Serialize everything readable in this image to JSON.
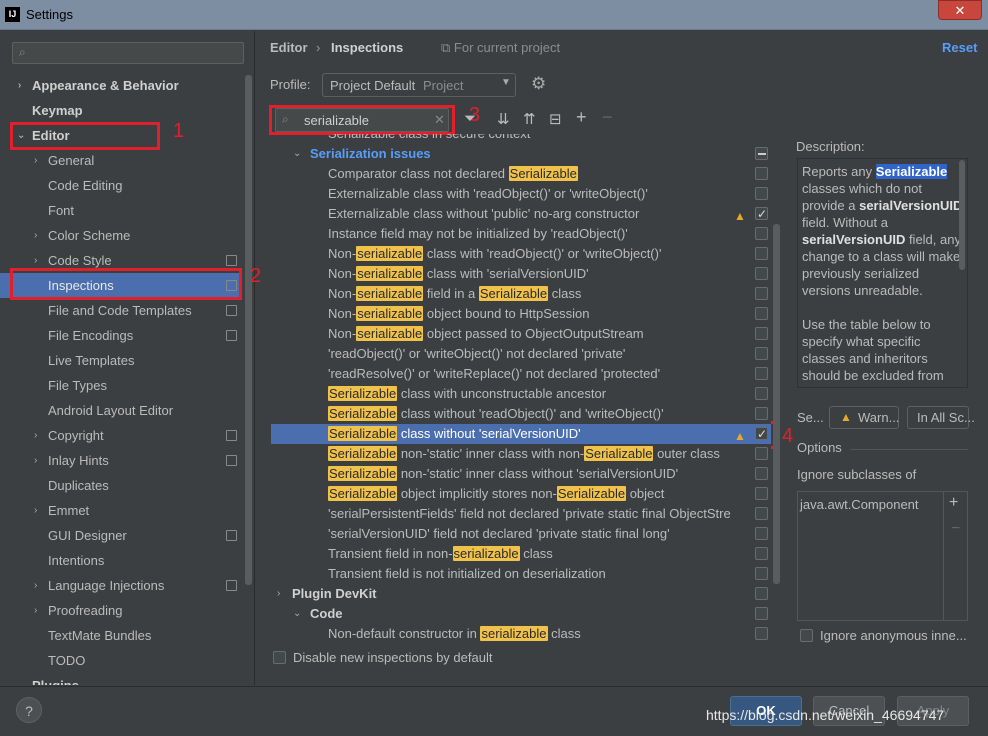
{
  "window": {
    "title": "Settings",
    "app_icon_text": "IJ",
    "close": "✕"
  },
  "left": {
    "search_placeholder": "",
    "items": [
      {
        "label": "Appearance & Behavior",
        "arrow": "›",
        "bold": true
      },
      {
        "label": "Keymap",
        "bold": true
      },
      {
        "label": "Editor",
        "arrow": "⌄",
        "bold": true
      },
      {
        "label": "General",
        "arrow": "›"
      },
      {
        "label": "Code Editing"
      },
      {
        "label": "Font"
      },
      {
        "label": "Color Scheme",
        "arrow": "›"
      },
      {
        "label": "Code Style",
        "arrow": "›"
      },
      {
        "label": "Inspections"
      },
      {
        "label": "File and Code Templates"
      },
      {
        "label": "File Encodings"
      },
      {
        "label": "Live Templates"
      },
      {
        "label": "File Types"
      },
      {
        "label": "Android Layout Editor"
      },
      {
        "label": "Copyright",
        "arrow": "›"
      },
      {
        "label": "Inlay Hints",
        "arrow": "›"
      },
      {
        "label": "Duplicates"
      },
      {
        "label": "Emmet",
        "arrow": "›"
      },
      {
        "label": "GUI Designer"
      },
      {
        "label": "Intentions"
      },
      {
        "label": "Language Injections",
        "arrow": "›"
      },
      {
        "label": "Proofreading",
        "arrow": "›"
      },
      {
        "label": "TextMate Bundles"
      },
      {
        "label": "TODO"
      },
      {
        "label": "Plugins",
        "bold": true
      }
    ]
  },
  "annotations": {
    "n1": "1",
    "n2": "2",
    "n3": "3",
    "n4": "4"
  },
  "header": {
    "crumb1": "Editor",
    "sep": "›",
    "crumb2": "Inspections",
    "for_project": "⧉ For current project",
    "reset": "Reset"
  },
  "profile": {
    "label": "Profile:",
    "value": "Project Default",
    "type": "Project"
  },
  "search": {
    "value": "serializable"
  },
  "toolbar": {
    "filter": "⏷",
    "expand": "⇊",
    "collapse": "⇈",
    "reset_icon": "⊟",
    "add": "+",
    "remove": "−"
  },
  "list": {
    "partial_top": "Serializable class in secure context",
    "group": "Serialization issues",
    "rows": [
      {
        "pre": "Comparator class not declared ",
        "hl": "Serializable",
        "post": ""
      },
      {
        "pre": "Externalizable class with 'readObject()' or 'writeObject()'",
        "hl": "",
        "post": ""
      },
      {
        "pre": "Externalizable class without 'public' no-arg constructor",
        "hl": "",
        "post": ""
      },
      {
        "pre": "Instance field may not be initialized by 'readObject()'",
        "hl": "",
        "post": ""
      },
      {
        "pre": "Non-",
        "hl": "serializable",
        "post": " class with 'readObject()' or 'writeObject()'"
      },
      {
        "pre": "Non-",
        "hl": "serializable",
        "post": " class with 'serialVersionUID'"
      },
      {
        "pre": "Non-",
        "hl": "serializable",
        "post": " field in a ",
        "hl2": "Serializable",
        "post2": " class"
      },
      {
        "pre": "Non-",
        "hl": "serializable",
        "post": " object bound to HttpSession"
      },
      {
        "pre": "Non-",
        "hl": "serializable",
        "post": " object passed to ObjectOutputStream"
      },
      {
        "pre": "'readObject()' or 'writeObject()' not declared 'private'",
        "hl": "",
        "post": ""
      },
      {
        "pre": "'readResolve()' or 'writeReplace()' not declared 'protected'",
        "hl": "",
        "post": ""
      },
      {
        "pre": "",
        "hl": "Serializable",
        "post": " class with unconstructable ancestor"
      },
      {
        "pre": "",
        "hl": "Serializable",
        "post": " class without 'readObject()' and 'writeObject()'"
      },
      {
        "pre": "",
        "hl": "Serializable",
        "post": " class without 'serialVersionUID'"
      },
      {
        "pre": "",
        "hl": "Serializable",
        "post": " non-'static' inner class with non-",
        "hl2": "Serializable",
        "post2": " outer class"
      },
      {
        "pre": "",
        "hl": "Serializable",
        "post": " non-'static' inner class without 'serialVersionUID'"
      },
      {
        "pre": "",
        "hl": "Serializable",
        "post": " object implicitly stores non-",
        "hl2": "Serializable",
        "post2": " object"
      },
      {
        "pre": "'serialPersistentFields' field not declared 'private static final ObjectStre",
        "hl": "",
        "post": ""
      },
      {
        "pre": "'serialVersionUID' field not declared 'private static final long'",
        "hl": "",
        "post": ""
      },
      {
        "pre": "Transient field in non-",
        "hl": "serializable",
        "post": " class"
      },
      {
        "pre": "Transient field is not initialized on deserialization",
        "hl": "",
        "post": ""
      }
    ],
    "group2": "Plugin DevKit",
    "subgroup": "Code",
    "last_row": {
      "pre": "Non-default constructor in ",
      "hl": "serializable",
      "post": " class"
    },
    "disable_label": "Disable new inspections by default"
  },
  "description": {
    "label": "Description:",
    "p1_pre": "Reports any ",
    "p1_sel": "Serializable",
    "p1_a": " classes which do not provide a ",
    "p1_b": "serialVersionUID",
    "p1_c": " field. Without a ",
    "p1_d": "serialVersionUID",
    "p1_e": " field, any change to a class will make previously serialized versions unreadable.",
    "p2": "Use the table below to specify what specific classes and inheritors should be excluded from being"
  },
  "severity": {
    "label": "Se...",
    "value": "Warn...",
    "scope": "In All Sc..."
  },
  "options": {
    "label": "Options",
    "ignore_subclasses": "Ignore subclasses of",
    "class_value": "java.awt.Component",
    "add": "+",
    "remove": "−",
    "ignore_anonymous": "Ignore anonymous inne..."
  },
  "buttons": {
    "help": "?",
    "ok": "OK",
    "cancel": "Cancel",
    "apply": "Apply"
  },
  "watermark": "https://blog.csdn.net/weixin_46694747"
}
